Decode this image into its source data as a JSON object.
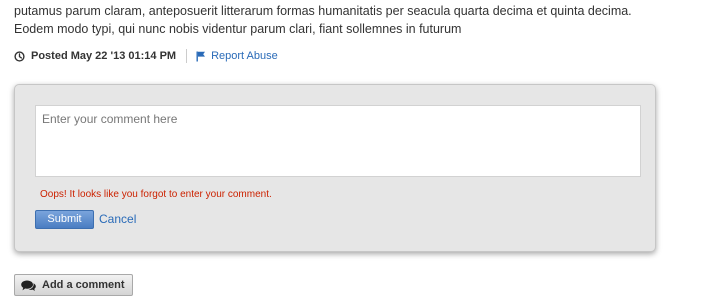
{
  "post": {
    "body_lines": [
      "putamus parum claram, anteposuerit litterarum formas humanitatis per seacula quarta decima et quinta decima.",
      "Eodem modo typi, qui nunc nobis videntur parum clari, fiant sollemnes in futurum"
    ],
    "posted_text": "Posted May 22 '13 01:14 PM",
    "report_label": "Report Abuse"
  },
  "comment_form": {
    "placeholder": "Enter your comment here",
    "value": "",
    "error_message": "Oops! It looks like you forgot to enter your comment.",
    "submit_label": "Submit",
    "cancel_label": "Cancel"
  },
  "add_comment": {
    "label": "Add a comment"
  },
  "icons": {
    "posted": "clock-icon",
    "report": "flag-icon",
    "add_comment": "speech-bubbles-icon"
  },
  "colors": {
    "link": "#2a6bb8",
    "error": "#cc2200",
    "submit_bg": "#4a7dc2"
  }
}
